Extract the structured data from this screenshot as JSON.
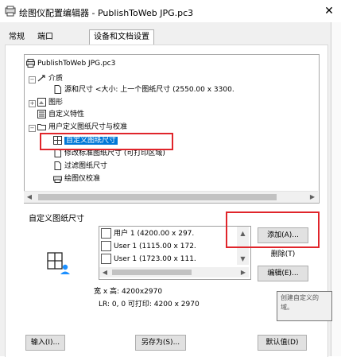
{
  "window": {
    "title": "绘图仪配置编辑器 - PublishToWeb JPG.pc3",
    "close_glyph": "✕"
  },
  "tabs": [
    {
      "label": "常规",
      "active": false
    },
    {
      "label": "端口",
      "active": false
    },
    {
      "label": "设备和文档设置",
      "active": true
    }
  ],
  "tree": {
    "root": "PublishToWeb JPG.pc3",
    "nodes": [
      {
        "label": "介质",
        "expander": "−"
      },
      {
        "label": "源和尺寸 <大小: 上一个图纸尺寸   (2550.00 x 3300.",
        "expander": ""
      },
      {
        "label": "图形",
        "expander": "+"
      },
      {
        "label": "自定义特性",
        "expander": ""
      },
      {
        "label": "用户定义图纸尺寸与校准",
        "expander": "−"
      },
      {
        "label": "自定义图纸尺寸",
        "expander": ""
      },
      {
        "label": "修改标准图纸尺寸 (可打印区域)",
        "expander": ""
      },
      {
        "label": "过滤图纸尺寸",
        "expander": ""
      },
      {
        "label": "绘图仪校准",
        "expander": ""
      }
    ]
  },
  "paper_sizes": {
    "group_label": "自定义图纸尺寸",
    "items": [
      {
        "label": "用户 1 (4200.00 x 297."
      },
      {
        "label": "User 1 (1115.00 x 172."
      },
      {
        "label": "User 1 (1723.00 x 111."
      }
    ],
    "info_line1": "宽 x 高:  4200x2970",
    "info_line2": "LR: 0, 0   可打印: 4200 x 2970"
  },
  "buttons": {
    "add": "添加(A)...",
    "delete": "删除(T)",
    "edit": "编辑(E)...",
    "import": "输入(I)...",
    "save_as": "另存为(S)...",
    "defaults": "默认值(D)"
  },
  "tooltip": {
    "line1": "创建自定义的",
    "line2": "域。"
  },
  "colors": {
    "accent": "#0078d7",
    "highlight_box": "#e0252b"
  }
}
